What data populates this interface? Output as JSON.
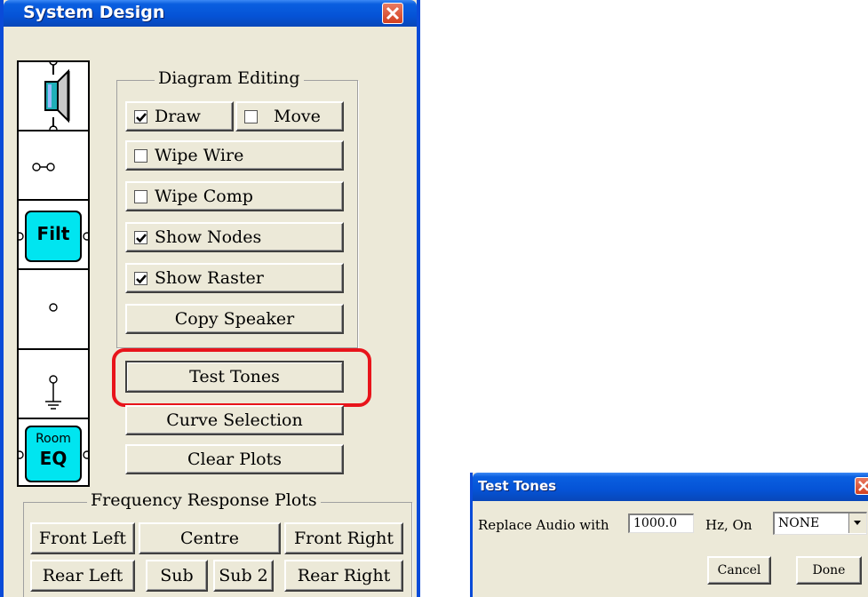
{
  "system_design": {
    "title": "System Design",
    "diagram_editing": {
      "label": "Diagram Editing",
      "draw": {
        "label": "Draw",
        "checked": true
      },
      "move": {
        "label": "Move",
        "checked": false
      },
      "wipe_wire": {
        "label": "Wipe Wire",
        "checked": false
      },
      "wipe_comp": {
        "label": "Wipe Comp",
        "checked": false
      },
      "show_nodes": {
        "label": "Show Nodes",
        "checked": true
      },
      "show_raster": {
        "label": "Show Raster",
        "checked": true
      },
      "copy_speaker": "Copy Speaker"
    },
    "test_tones_button": "Test Tones",
    "curve_selection_button": "Curve Selection",
    "clear_plots_button": "Clear Plots",
    "components": {
      "filter": "Filt",
      "room_eq_top": "Room",
      "room_eq_bottom": "EQ"
    },
    "frequency_response": {
      "label": "Frequency Response Plots",
      "front_left": "Front Left",
      "centre": "Centre",
      "front_right": "Front Right",
      "rear_left": "Rear Left",
      "sub": "Sub",
      "sub2": "Sub 2",
      "rear_right": "Rear Right"
    },
    "accent_colors": {
      "component_fill": "#00e5f0",
      "highlight": "#e8141b"
    }
  },
  "test_tones_dialog": {
    "title": "Test Tones",
    "replace_label": "Replace Audio with",
    "frequency_value": "1000.0",
    "hz_on_label": "Hz, On",
    "channel_value": "NONE",
    "cancel_button": "Cancel",
    "done_button": "Done"
  }
}
